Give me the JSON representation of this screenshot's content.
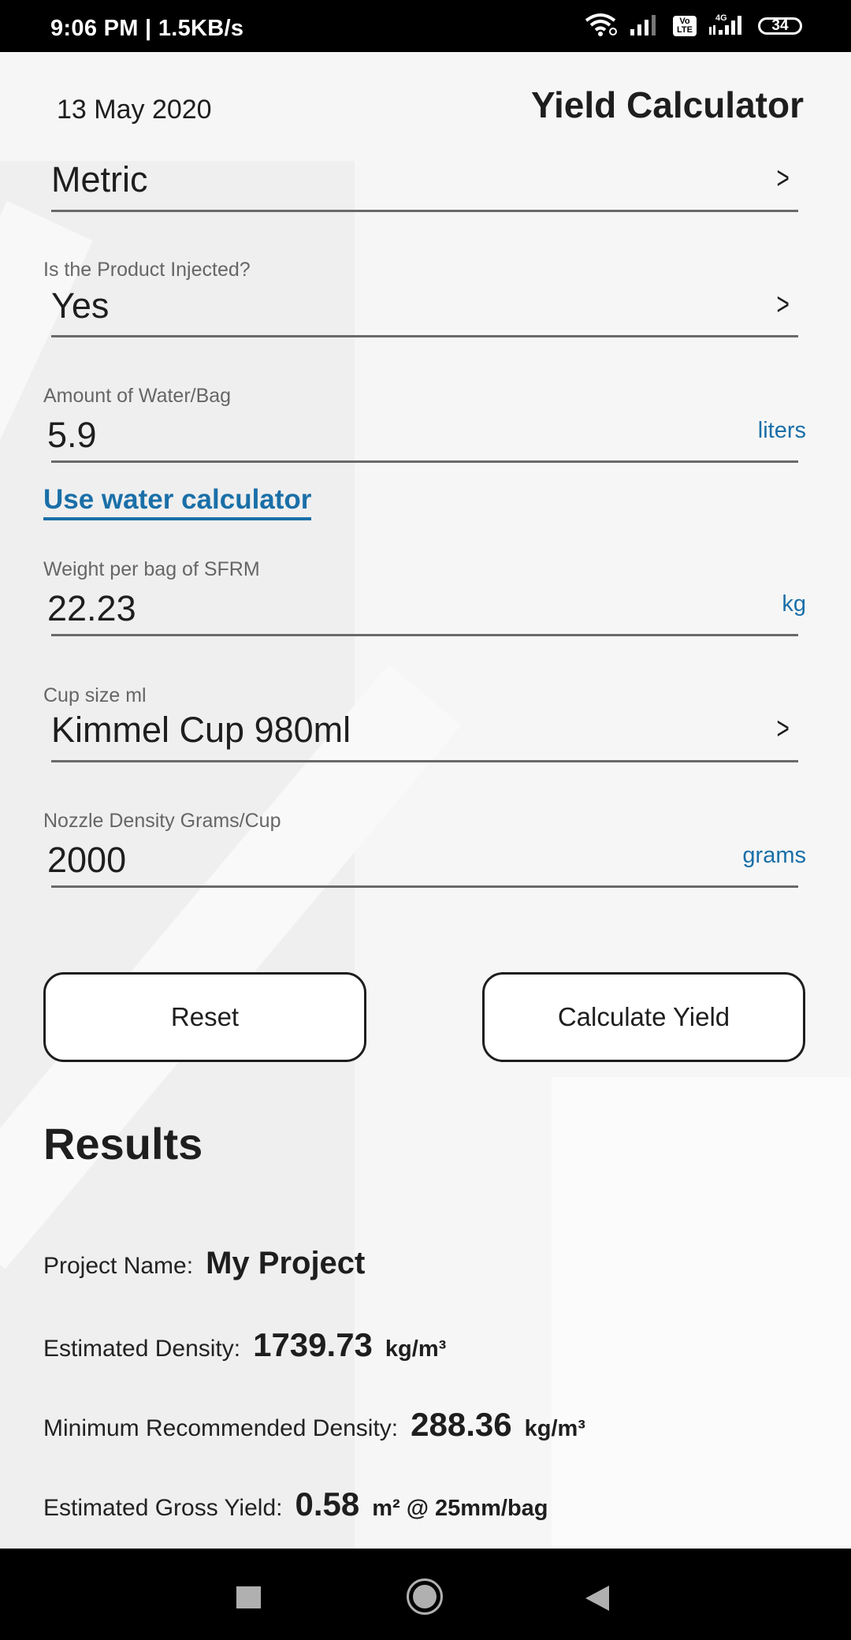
{
  "status_bar": {
    "time_speed": "9:06 PM | 1.5KB/s",
    "icons": [
      "wifi-icon",
      "signal-icon",
      "volte-icon",
      "4g-signal-icon",
      "battery-icon"
    ],
    "volte_label": "Vo LTE",
    "network_label": "4G",
    "battery_level": "34"
  },
  "header": {
    "date": "13 May 2020",
    "title": "Yield Calculator"
  },
  "form": {
    "unit_system": {
      "value": "Metric",
      "icon": "chevron-right-icon"
    },
    "injected": {
      "label": "Is the Product Injected?",
      "value": "Yes",
      "icon": "chevron-right-icon"
    },
    "water": {
      "label": "Amount of Water/Bag",
      "value": "5.9",
      "unit": "liters"
    },
    "water_calculator_link": "Use water calculator",
    "weight": {
      "label": "Weight per bag of SFRM",
      "value": "22.23",
      "unit": "kg"
    },
    "cup_size": {
      "label": "Cup size ml",
      "value": "Kimmel Cup 980ml",
      "icon": "chevron-right-icon"
    },
    "nozzle_density": {
      "label": "Nozzle Density Grams/Cup",
      "value": "2000",
      "unit": "grams"
    }
  },
  "buttons": {
    "reset": "Reset",
    "calculate": "Calculate Yield"
  },
  "results": {
    "title": "Results",
    "project": {
      "label": "Project Name:",
      "value": "My Project"
    },
    "estimated_density": {
      "label": "Estimated Density:",
      "value": "1739.73",
      "unit": "kg/m³"
    },
    "min_density": {
      "label": "Minimum Recommended Density:",
      "value": "288.36",
      "unit": "kg/m³"
    },
    "gross_yield": {
      "label": "Estimated Gross Yield:",
      "value": "0.58",
      "unit": "m² @ 25mm/bag"
    }
  },
  "nav_bar": {
    "icons": [
      "recent-apps-icon",
      "home-icon",
      "back-icon"
    ]
  },
  "colors": {
    "accent": "#1a6fa8",
    "text": "#1e1e1e",
    "label": "#666666"
  }
}
